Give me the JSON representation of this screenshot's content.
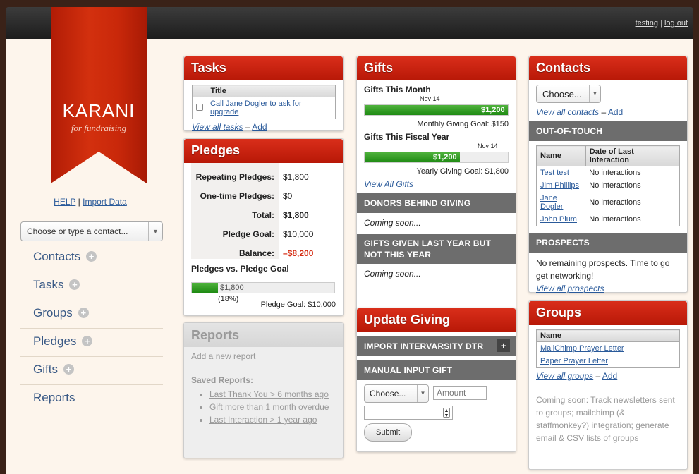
{
  "top": {
    "user": "testing",
    "sep": "|",
    "logout": "log out"
  },
  "brand": {
    "name": "KARANI",
    "tagline": "for fundraising"
  },
  "side": {
    "help": "HELP",
    "sep": "|",
    "import": "Import Data",
    "contact_select": "Choose or type a contact...",
    "nav": [
      {
        "label": "Contacts",
        "plus": true
      },
      {
        "label": "Tasks",
        "plus": true
      },
      {
        "label": "Groups",
        "plus": true
      },
      {
        "label": "Pledges",
        "plus": true
      },
      {
        "label": "Gifts",
        "plus": true
      },
      {
        "label": "Reports",
        "plus": false
      }
    ]
  },
  "tasks": {
    "title": "Tasks",
    "col": "Title",
    "row": "Call Jane Dogler to ask for upgrade",
    "view_all": "View all tasks",
    "dash": "–",
    "add": "Add"
  },
  "pledges": {
    "title": "Pledges",
    "rows": [
      {
        "label": "Repeating Pledges:",
        "value": "$1,800"
      },
      {
        "label": "One-time Pledges:",
        "value": "$0"
      },
      {
        "label": "Total:",
        "value": "$1,800"
      },
      {
        "label": "Pledge Goal:",
        "value": "$10,000"
      },
      {
        "label": "Balance:",
        "value": "–$8,200"
      }
    ],
    "vs_title": "Pledges vs. Pledge Goal",
    "progress": 0.18,
    "bar_label": "$1,800",
    "pct": "(18%)",
    "goal": "Pledge Goal: $10,000"
  },
  "reports": {
    "title": "Reports",
    "add": "Add a new report",
    "saved": "Saved Reports:",
    "items": [
      "Last Thank You > 6 months ago",
      "Gift more than 1 month overdue",
      "Last Interaction > 1 year ago"
    ]
  },
  "gifts": {
    "title": "Gifts",
    "month_title": "Gifts This Month",
    "month_marker": "Nov 14",
    "month_bar": "$1,200",
    "month_progress": 1.0,
    "month_goal": "Monthly Giving Goal: $150",
    "fy_title": "Gifts This Fiscal Year",
    "fy_marker": "Nov 14",
    "fy_bar": "$1,200",
    "fy_progress": 0.667,
    "fy_goal": "Yearly Giving Goal: $1,800",
    "view_all": "View All Gifts",
    "donors_behind": "DONORS BEHIND GIVING",
    "soon1": "Coming soon...",
    "last_year": "GIFTS GIVEN LAST YEAR BUT NOT THIS YEAR",
    "soon2": "Coming soon..."
  },
  "update": {
    "title": "Update Giving",
    "import": "IMPORT INTERVARSITY DTR",
    "import_btn": "+",
    "manual": "MANUAL INPUT GIFT",
    "choose": "Choose...",
    "amount_ph": "Amount",
    "submit": "Submit"
  },
  "contacts": {
    "title": "Contacts",
    "choose": "Choose...",
    "view_all": "View all contacts",
    "dash": "–",
    "add": "Add",
    "out_title": "OUT-OF-TOUCH",
    "col_name": "Name",
    "col_date": "Date of Last Interaction",
    "rows": [
      {
        "name": "Test test",
        "date": "No interactions"
      },
      {
        "name": "Jim Phillips",
        "date": "No interactions"
      },
      {
        "name": "Jane Dogler",
        "date": "No interactions"
      },
      {
        "name": "John Plum",
        "date": "No interactions"
      }
    ],
    "prospects_title": "PROSPECTS",
    "prospects_text": "No remaining prospects. Time to go get networking!",
    "prospects_link": "View all prospects"
  },
  "groups": {
    "title": "Groups",
    "col": "Name",
    "rows": [
      "MailChimp Prayer Letter",
      "Paper Prayer Letter"
    ],
    "view_all": "View all groups",
    "dash": "–",
    "add": "Add",
    "soon": "Coming soon: Track newsletters sent to groups; mailchimp (& staffmonkey?) integration; generate email & CSV lists of groups"
  },
  "colors": {
    "accent": "#c8200c",
    "section": "#6d6d6d",
    "link": "#2a5a9a",
    "bar": "#1e8a12",
    "negative": "#d42a10"
  }
}
